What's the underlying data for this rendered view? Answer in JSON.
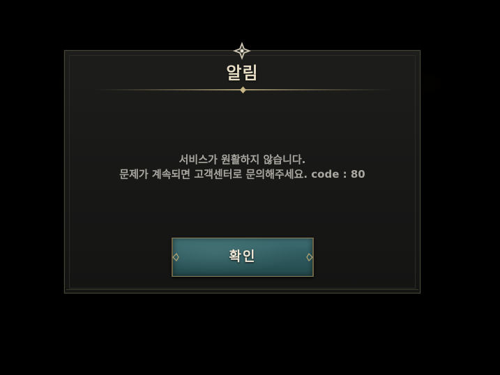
{
  "dialog": {
    "title": "알림",
    "message_line1": "서비스가 원활하지 않습니다.",
    "message_line2": "문제가 계속되면 고객센터로 문의해주세요.  code : 80",
    "confirm_label": "확인"
  },
  "colors": {
    "background": "#000000",
    "panel": "#1a1a18",
    "title_text": "#e6dcc4",
    "message_text": "#a9a7a0",
    "button_teal": "#2f5a5e",
    "gold_trim": "#8f8560"
  }
}
